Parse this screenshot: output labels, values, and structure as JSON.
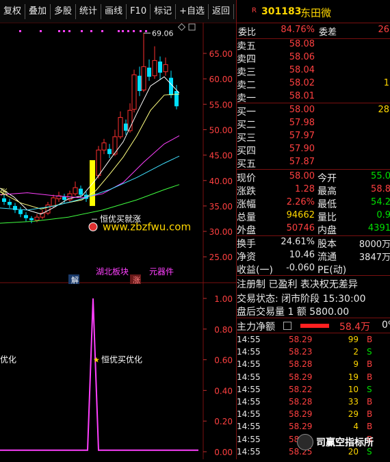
{
  "toolbar": {
    "buttons": [
      "复权",
      "叠加",
      "多股",
      "统计",
      "画线",
      "F10",
      "标记",
      "+自选",
      "返回"
    ]
  },
  "chart": {
    "price_ticks": [
      "65.00",
      "60.00",
      "55.00",
      "50.00",
      "45.00",
      "40.00",
      "35.00",
      "30.00",
      "25.00"
    ],
    "high_label": "69.06",
    "signal_label": "恒优买就涨",
    "plate_label": "湖北板块",
    "sector_label": "元器件",
    "jie_label": "解",
    "zhang_label": "涨",
    "left_edge_label": "张",
    "sub_ticks": [
      "1.00",
      "0.80",
      "0.60",
      "0.40",
      "0.20",
      "0.00"
    ],
    "sub_signal_label": "恒优买优化",
    "sub_left_label": "优化",
    "colors": {
      "up": "#ff3030",
      "down": "#00e0ff",
      "signal": "#ffff00",
      "ma5": "#ffffff",
      "ma10": "#ffff80",
      "ma20": "#ff40ff",
      "ma30": "#40e0ff",
      "ma60": "#40ff40",
      "indicator": "#ff40ff"
    }
  },
  "stock": {
    "badge": "R",
    "code": "301183",
    "name": "东田微"
  },
  "order_book": {
    "weibi_label": "委比",
    "weibi_value": "84.76%",
    "weicha_label": "委差",
    "weicha_value": "26",
    "sells": [
      {
        "label": "卖五",
        "price": "58.08",
        "vol": ""
      },
      {
        "label": "卖四",
        "price": "58.06",
        "vol": ""
      },
      {
        "label": "卖三",
        "price": "58.04",
        "vol": ""
      },
      {
        "label": "卖二",
        "price": "58.02",
        "vol": "1"
      },
      {
        "label": "卖一",
        "price": "58.01",
        "vol": ""
      }
    ],
    "buys": [
      {
        "label": "买一",
        "price": "58.00",
        "vol": "28"
      },
      {
        "label": "买二",
        "price": "57.98",
        "vol": ""
      },
      {
        "label": "买三",
        "price": "57.97",
        "vol": ""
      },
      {
        "label": "买四",
        "price": "57.90",
        "vol": ""
      },
      {
        "label": "买五",
        "price": "57.87",
        "vol": ""
      }
    ]
  },
  "quote": {
    "rows": [
      {
        "l1": "现价",
        "v1": "58.00",
        "c1": "red",
        "l2": "今开",
        "v2": "55.0",
        "c2": "green"
      },
      {
        "l1": "涨跌",
        "v1": "1.28",
        "c1": "red",
        "l2": "最高",
        "v2": "58.8",
        "c2": "red"
      },
      {
        "l1": "涨幅",
        "v1": "2.26%",
        "c1": "red",
        "l2": "最低",
        "v2": "54.2",
        "c2": "green"
      },
      {
        "l1": "总量",
        "v1": "94662",
        "c1": "yellow",
        "l2": "量比",
        "v2": "0.9",
        "c2": "green"
      },
      {
        "l1": "外盘",
        "v1": "50746",
        "c1": "red",
        "l2": "内盘",
        "v2": "4391",
        "c2": "green"
      }
    ],
    "rows2": [
      {
        "l1": "换手",
        "v1": "24.61%",
        "l2": "股本",
        "v2": "8000万"
      },
      {
        "l1": "净资",
        "v1": "10.46",
        "l2": "流通",
        "v2": "3847万"
      },
      {
        "l1": "收益(一)",
        "v1": "-0.060",
        "l2": "PE(动)",
        "v2": ""
      }
    ]
  },
  "info": {
    "line1": "注册制 已盈利 表决权无差异",
    "line2": "交易状态: 闭市阶段 15:30:00",
    "line3": "盘后交易量 1 额 5800.00"
  },
  "main_flow": {
    "label": "主力净额",
    "value": "58.4万",
    "pct": "0%"
  },
  "trades": [
    {
      "t": "14:55",
      "p": "58.29",
      "v": "99",
      "d": "B"
    },
    {
      "t": "14:55",
      "p": "58.23",
      "v": "2",
      "d": "S"
    },
    {
      "t": "14:55",
      "p": "58.28",
      "v": "9",
      "d": "B"
    },
    {
      "t": "14:55",
      "p": "58.29",
      "v": "19",
      "d": "B"
    },
    {
      "t": "14:55",
      "p": "58.22",
      "v": "10",
      "d": "S"
    },
    {
      "t": "14:55",
      "p": "58.28",
      "v": "33",
      "d": "B"
    },
    {
      "t": "14:55",
      "p": "58.29",
      "v": "29",
      "d": "B"
    },
    {
      "t": "14:55",
      "p": "58.29",
      "v": "4",
      "d": "B"
    },
    {
      "t": "14:55",
      "p": "58.28",
      "v": "",
      "d": "B"
    },
    {
      "t": "14:55",
      "p": "58.25",
      "v": "20",
      "d": "S"
    }
  ],
  "watermark": {
    "site": "www.zbzfwu.com",
    "brand": "司赢空指标所"
  }
}
